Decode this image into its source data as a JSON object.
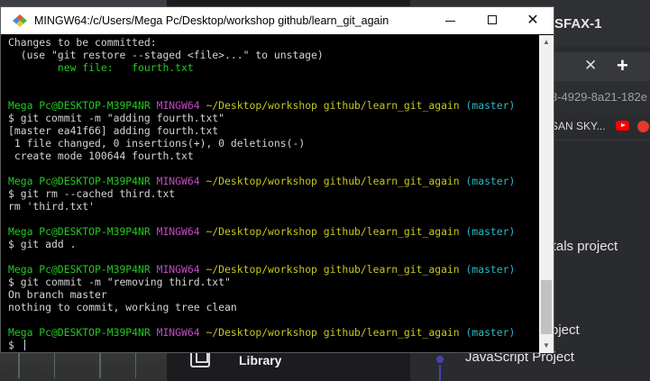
{
  "window": {
    "title": "MINGW64:/c/Users/Mega Pc/Desktop/workshop github/learn_git_again",
    "minimize_icon": "minimize-icon",
    "maximize_icon": "maximize-icon",
    "close_label": "✕"
  },
  "background": {
    "browser_tab_title": "SFAX-1",
    "tab_close": "✕",
    "tab_add": "+",
    "url_fragment": "3-4929-8a21-182e",
    "bookmark_text": "SAN SKY...",
    "project_a": "entals project",
    "project_b": "oject",
    "project_c": "JavaScript Project",
    "library_label": "Library"
  },
  "terminal": {
    "lines": [
      [
        {
          "t": "Changes to be committed:",
          "c": "w"
        }
      ],
      [
        {
          "t": "  (use \"git restore --staged <file>...\" to unstage)",
          "c": "w"
        }
      ],
      [
        {
          "t": "        new file:   fourth.txt",
          "c": "g"
        }
      ],
      [],
      [],
      [
        {
          "t": "Mega Pc@DESKTOP-M39P4NR",
          "c": "g"
        },
        {
          "t": " ",
          "c": "w"
        },
        {
          "t": "MINGW64",
          "c": "m"
        },
        {
          "t": " ",
          "c": "w"
        },
        {
          "t": "~/Desktop/workshop github/learn_git_again",
          "c": "y"
        },
        {
          "t": " ",
          "c": "w"
        },
        {
          "t": "(master)",
          "c": "c"
        }
      ],
      [
        {
          "t": "$ git commit -m \"adding fourth.txt\"",
          "c": "w"
        }
      ],
      [
        {
          "t": "[master ea41f66] adding fourth.txt",
          "c": "w"
        }
      ],
      [
        {
          "t": " 1 file changed, 0 insertions(+), 0 deletions(-)",
          "c": "w"
        }
      ],
      [
        {
          "t": " create mode 100644 fourth.txt",
          "c": "w"
        }
      ],
      [],
      [
        {
          "t": "Mega Pc@DESKTOP-M39P4NR",
          "c": "g"
        },
        {
          "t": " ",
          "c": "w"
        },
        {
          "t": "MINGW64",
          "c": "m"
        },
        {
          "t": " ",
          "c": "w"
        },
        {
          "t": "~/Desktop/workshop github/learn_git_again",
          "c": "y"
        },
        {
          "t": " ",
          "c": "w"
        },
        {
          "t": "(master)",
          "c": "c"
        }
      ],
      [
        {
          "t": "$ git rm --cached third.txt",
          "c": "w"
        }
      ],
      [
        {
          "t": "rm 'third.txt'",
          "c": "w"
        }
      ],
      [],
      [
        {
          "t": "Mega Pc@DESKTOP-M39P4NR",
          "c": "g"
        },
        {
          "t": " ",
          "c": "w"
        },
        {
          "t": "MINGW64",
          "c": "m"
        },
        {
          "t": " ",
          "c": "w"
        },
        {
          "t": "~/Desktop/workshop github/learn_git_again",
          "c": "y"
        },
        {
          "t": " ",
          "c": "w"
        },
        {
          "t": "(master)",
          "c": "c"
        }
      ],
      [
        {
          "t": "$ git add .",
          "c": "w"
        }
      ],
      [],
      [
        {
          "t": "Mega Pc@DESKTOP-M39P4NR",
          "c": "g"
        },
        {
          "t": " ",
          "c": "w"
        },
        {
          "t": "MINGW64",
          "c": "m"
        },
        {
          "t": " ",
          "c": "w"
        },
        {
          "t": "~/Desktop/workshop github/learn_git_again",
          "c": "y"
        },
        {
          "t": " ",
          "c": "w"
        },
        {
          "t": "(master)",
          "c": "c"
        }
      ],
      [
        {
          "t": "$ git commit -m \"removing third.txt\"",
          "c": "w"
        }
      ],
      [
        {
          "t": "On branch master",
          "c": "w"
        }
      ],
      [
        {
          "t": "nothing to commit, working tree clean",
          "c": "w"
        }
      ],
      [],
      [
        {
          "t": "Mega Pc@DESKTOP-M39P4NR",
          "c": "g"
        },
        {
          "t": " ",
          "c": "w"
        },
        {
          "t": "MINGW64",
          "c": "m"
        },
        {
          "t": " ",
          "c": "w"
        },
        {
          "t": "~/Desktop/workshop github/learn_git_again",
          "c": "y"
        },
        {
          "t": " ",
          "c": "w"
        },
        {
          "t": "(master)",
          "c": "c"
        }
      ],
      [
        {
          "t": "$ ",
          "c": "w"
        }
      ]
    ]
  },
  "colors": {
    "green": "#23c923",
    "magenta": "#c24ac2",
    "yellow": "#c7c71f",
    "cyan": "#2ab8c7",
    "text": "#c8c8c8"
  },
  "icons": {
    "app": "git-bash-diamond-icon",
    "youtube": "youtube-icon",
    "library": "library-icon"
  }
}
